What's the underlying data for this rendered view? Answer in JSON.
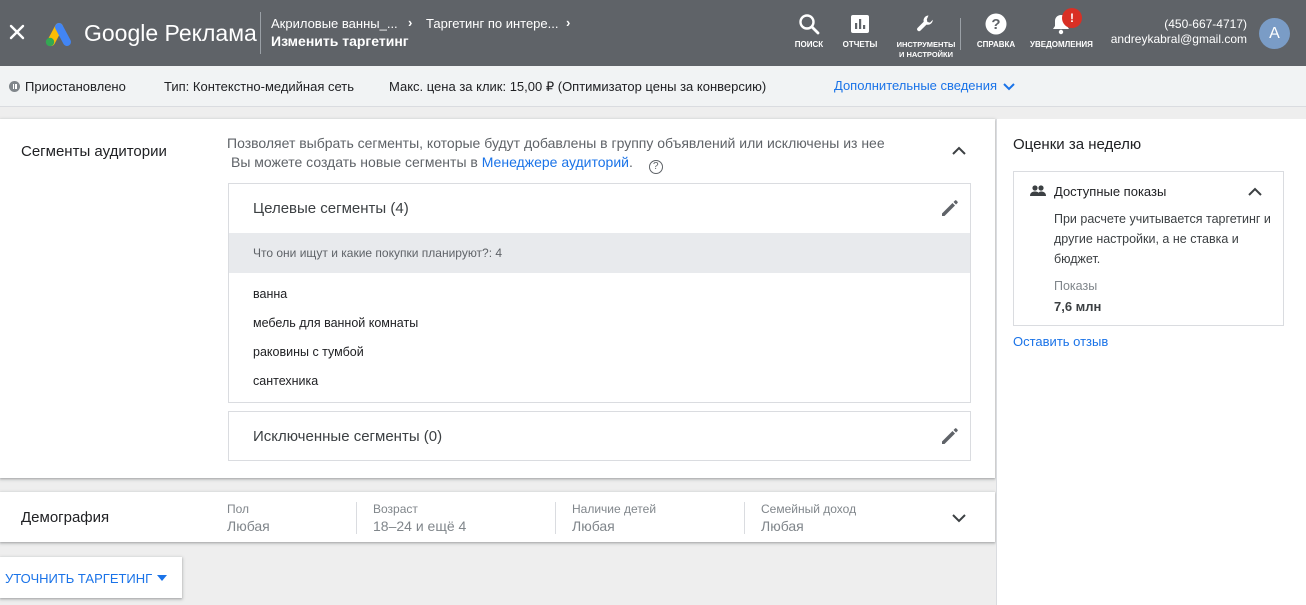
{
  "header": {
    "brand": "Google Реклама",
    "breadcrumb": [
      "Акриловые ванны_...",
      "Таргетинг по интере..."
    ],
    "page_title": "Изменить таргетинг",
    "tools": [
      {
        "label": "ПОИСК",
        "icon": "search-icon"
      },
      {
        "label": "ОТЧЕТЫ",
        "icon": "reports-icon"
      },
      {
        "label": "ИНСТРУМЕНТЫ И НАСТРОЙКИ",
        "icon": "wrench-icon"
      },
      {
        "label": "СПРАВКА",
        "icon": "help-icon"
      },
      {
        "label": "УВЕДОМЛЕНИЯ",
        "icon": "bell-icon"
      }
    ],
    "notification_badge": "!",
    "account_phone": "(450-667-4717)",
    "account_email": "andreykabral@gmail.com",
    "avatar_letter": "A"
  },
  "status_bar": {
    "status": "Приостановлено",
    "type": "Тип: Контекстно-медийная сеть",
    "bid": "Макс. цена за клик: 15,00 ₽ (Оптимизатор цены за конверсию)",
    "details_link": "Дополнительные сведения"
  },
  "audience": {
    "label": "Сегменты аудитории",
    "description": "Позволяет выбрать сегменты, которые будут добавлены в группу объявлений или исключены из нее",
    "description2": "Вы можете создать новые сегменты в",
    "manager_link": "Менеджере аудиторий",
    "period": ".",
    "help_glyph": "?",
    "target": {
      "title": "Целевые сегменты (4)",
      "category": "Что они ищут и какие покупки планируют?: 4",
      "items": [
        "ванна",
        "мебель для ванной комнаты",
        "раковины с тумбой",
        "сантехника"
      ]
    },
    "excluded": {
      "title": "Исключенные сегменты (0)"
    }
  },
  "demography": {
    "label": "Демография",
    "columns": [
      {
        "key": "Пол",
        "value": "Любая"
      },
      {
        "key": "Возраст",
        "value": "18–24 и ещё 4"
      },
      {
        "key": "Наличие детей",
        "value": "Любая"
      },
      {
        "key": "Семейный доход",
        "value": "Любая"
      }
    ]
  },
  "refine_button": "УТОЧНИТЬ ТАРГЕТИНГ",
  "weekly": {
    "title": "Оценки за неделю",
    "reach_title": "Доступные показы",
    "reach_desc": "При расчете учитывается таргетинг и другие настройки, а не ставка и бюджет.",
    "impressions_label": "Показы",
    "impressions_value": "7,6 млн",
    "feedback_link": "Оставить отзыв"
  },
  "colors": {
    "topbar": "#5f6368",
    "link": "#1a73e8",
    "badge": "#d93025"
  }
}
